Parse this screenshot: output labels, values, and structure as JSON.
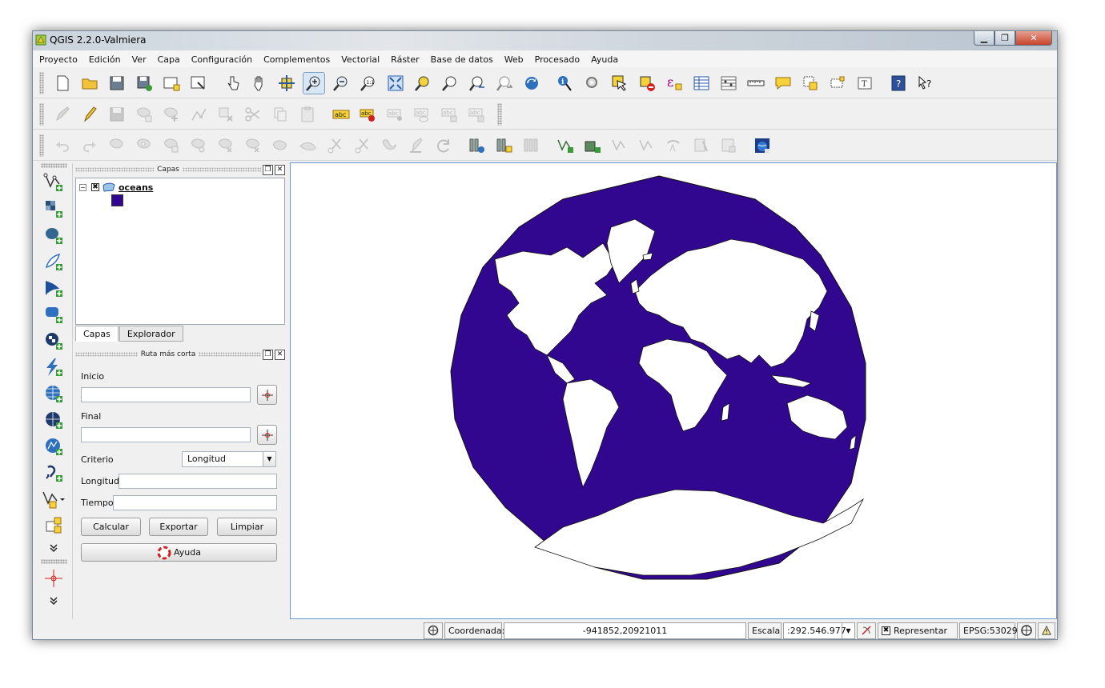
{
  "window": {
    "title": "QGIS 2.2.0-Valmiera",
    "controls": [
      "minimize",
      "restore",
      "close"
    ]
  },
  "menu": [
    "Proyecto",
    "Edición",
    "Ver",
    "Capa",
    "Configuración",
    "Complementos",
    "Vectorial",
    "Ráster",
    "Base de datos",
    "Web",
    "Procesado",
    "Ayuda"
  ],
  "toolbar_icons": {
    "row1": [
      "new-project-icon",
      "open-project-icon",
      "save-project-icon",
      "save-as-icon",
      "new-print-composer-icon",
      "composer-manager-icon",
      "touch-zoom-icon",
      "pan-icon",
      "pan-to-selection-icon",
      "zoom-in-icon",
      "zoom-out-icon",
      "zoom-actual-size-icon",
      "zoom-full-icon",
      "zoom-to-selection-icon",
      "zoom-to-layer-icon",
      "zoom-last-icon",
      "zoom-next-icon",
      "refresh-icon",
      "identify-icon",
      "run-action-icon",
      "select-features-icon",
      "deselect-icon",
      "field-calculator-icon",
      "attribute-table-icon",
      "statistics-icon",
      "measure-icon",
      "map-tips-icon",
      "new-bookmark-icon",
      "show-bookmarks-icon",
      "text-annotation-icon",
      "help-icon",
      "whats-this-icon"
    ],
    "row2": [
      "current-edits-icon",
      "toggle-editing-icon",
      "save-edits-icon",
      "add-feature-icon",
      "move-feature-icon",
      "node-tool-icon",
      "delete-selected-icon",
      "cut-features-icon",
      "copy-features-icon",
      "paste-features-icon",
      "label-icon",
      "pin-labels-icon",
      "show-hide-labels-icon",
      "move-label-icon",
      "rotate-label-icon",
      "change-label-icon"
    ],
    "row3": [
      "undo-icon",
      "redo-icon",
      "simplify-feature-icon",
      "add-ring-icon",
      "add-part-icon",
      "fill-ring-icon",
      "delete-ring-icon",
      "delete-part-icon",
      "reshape-features-icon",
      "offset-curve-icon",
      "split-features-icon",
      "split-parts-icon",
      "merge-selected-icon",
      "merge-attributes-icon",
      "rotate-point-symbols-icon",
      "new-raster-icon",
      "new-gpx-icon",
      "new-spatialite-icon",
      "add-vector-icon",
      "add-raster-icon",
      "add-postgis-icon",
      "add-spatialite-icon",
      "add-wms-icon",
      "add-wcs-icon",
      "openlayers-icon"
    ]
  },
  "left_tools": [
    "add-vector-layer-icon",
    "add-raster-layer-icon",
    "add-postgis-layer-icon",
    "add-spatialite-layer-icon",
    "add-mssql-layer-icon",
    "add-oracle-layer-icon",
    "add-sqlanywhere-layer-icon",
    "add-wfs-layer-icon",
    "add-wms-layer-icon",
    "add-wcs-layer-icon",
    "add-gpx-layer-icon",
    "add-delimited-text-icon",
    "new-shapefile-icon",
    "more-tools-icon"
  ],
  "layers_panel": {
    "title": "Capas",
    "layer_name": "oceans",
    "checked": "✖",
    "expand": "−",
    "fill_color": "#32078f"
  },
  "tabs": [
    "Capas",
    "Explorador"
  ],
  "route_panel": {
    "title": "Ruta más corta",
    "inicio_label": "Inicio",
    "final_label": "Final",
    "criterio_label": "Criterio",
    "criterio_value": "Longitud",
    "longitud_label": "Longitud",
    "tiempo_label": "Tiempo",
    "calcular": "Calcular",
    "exportar": "Exportar",
    "limpiar": "Limpiar",
    "ayuda": "Ayuda"
  },
  "map": {
    "ocean_color": "#32078f",
    "land_color": "#ffffff"
  },
  "statusbar": {
    "coord_label": "Coordenada:",
    "coord_value": "-941852,20921011",
    "scale_label": "Escala",
    "scale_value": ":292.546.977",
    "render_label": "Representar",
    "render_checked": "✖",
    "crs": "EPSG:53029"
  }
}
